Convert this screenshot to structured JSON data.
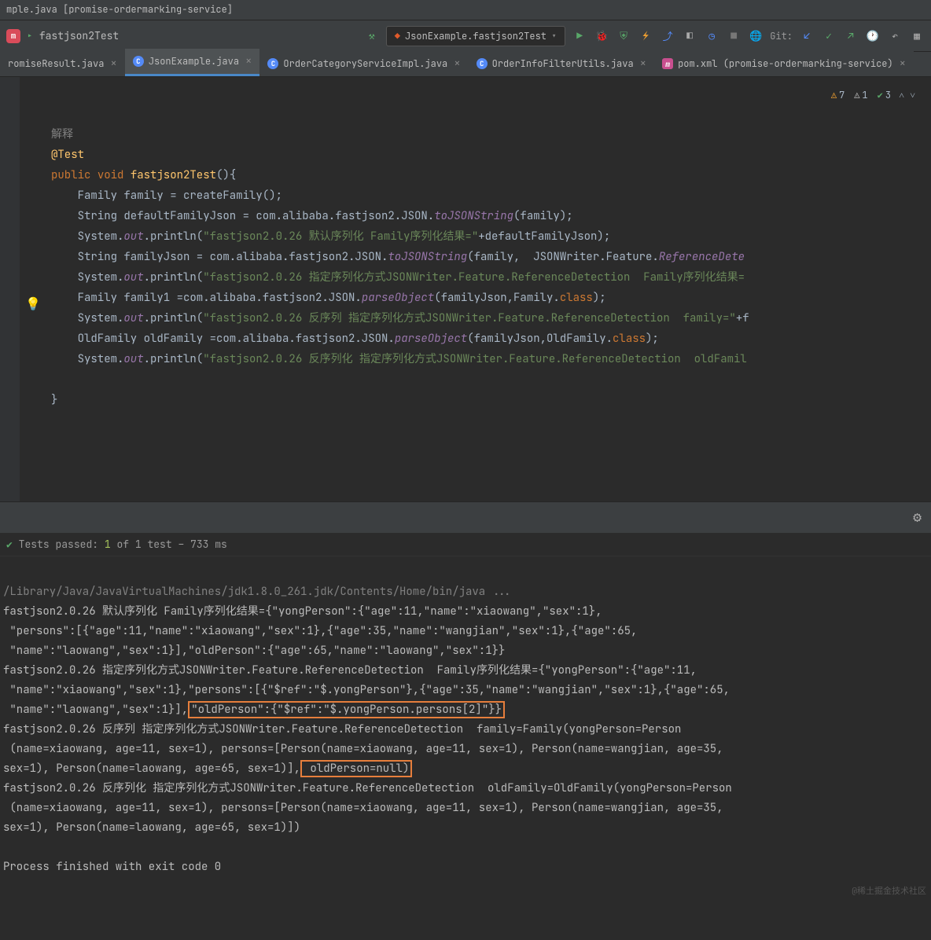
{
  "window": {
    "title": "mple.java [promise-ordermarking-service]"
  },
  "toolbar": {
    "project": "fastjson2Test",
    "run_config": "JsonExample.fastjson2Test",
    "git_label": "Git:"
  },
  "tabs": [
    {
      "icon": "c",
      "label": "romiseResult.java",
      "active": false
    },
    {
      "icon": "c",
      "label": "JsonExample.java",
      "active": true
    },
    {
      "icon": "c",
      "label": "OrderCategoryServiceImpl.java",
      "active": false
    },
    {
      "icon": "c",
      "label": "OrderInfoFilterUtils.java",
      "active": false
    },
    {
      "icon": "m",
      "label": "pom.xml (promise-ordermarking-service)",
      "active": false
    }
  ],
  "inspections": {
    "warn1": "7",
    "warn2": "1",
    "ok": "3"
  },
  "code": {
    "line1_comment": "解释",
    "line2_anno": "@Test",
    "line3_pub": "public ",
    "line3_void": "void ",
    "line3_fn": "fastjson2Test",
    "line3_rest": "(){",
    "line4": "    Family family = createFamily();",
    "line5a": "    String defaultFamilyJson = com.alibaba.fastjson2.JSON.",
    "line5b": "toJSONString",
    "line5c": "(family);",
    "line6a": "    System.",
    "line6b": "out",
    "line6c": ".println(",
    "line6d": "\"fastjson2.0.26 默认序列化 Family序列化结果=\"",
    "line6e": "+defaultFamilyJson);",
    "line7a": "    String familyJson = com.alibaba.fastjson2.JSON.",
    "line7b": "toJSONString",
    "line7c": "(family,  JSONWriter.Feature.",
    "line7d": "ReferenceDete",
    "line8a": "    System.",
    "line8b": "out",
    "line8c": ".println(",
    "line8d": "\"fastjson2.0.26 指定序列化方式JSONWriter.Feature.ReferenceDetection  Family序列化结果=",
    "line9a": "    Family family1 =com.alibaba.fastjson2.JSON.",
    "line9b": "parseObject",
    "line9c": "(familyJson,Family.",
    "line9d": "class",
    "line9e": ");",
    "line10a": "    System.",
    "line10b": "out",
    "line10c": ".println(",
    "line10d": "\"fastjson2.0.26 反序列 指定序列化方式JSONWriter.Feature.ReferenceDetection  family=\"",
    "line10e": "+f",
    "line11a": "    OldFamily oldFamily =com.alibaba.fastjson2.JSON.",
    "line11b": "parseObject",
    "line11c": "(familyJson,OldFamily.",
    "line11d": "class",
    "line11e": ");",
    "line12a": "    System.",
    "line12b": "out",
    "line12c": ".println(",
    "line12d": "\"fastjson2.0.26",
    "line12e": " 反序列化 指定序列化方式JSONWriter.Feature.ReferenceDetection  oldFamil",
    "line14": "}"
  },
  "test_status": {
    "prefix": "Tests passed: ",
    "passed": "1",
    "suffix": " of 1 test – 733 ms"
  },
  "console": {
    "cmd": "/Library/Java/JavaVirtualMachines/jdk1.8.0_261.jdk/Contents/Home/bin/java ...",
    "l1": "fastjson2.0.26 默认序列化 Family序列化结果={\"yongPerson\":{\"age\":11,\"name\":\"xiaowang\",\"sex\":1},",
    "l2": " \"persons\":[{\"age\":11,\"name\":\"xiaowang\",\"sex\":1},{\"age\":35,\"name\":\"wangjian\",\"sex\":1},{\"age\":65,",
    "l3": " \"name\":\"laowang\",\"sex\":1}],\"oldPerson\":{\"age\":65,\"name\":\"laowang\",\"sex\":1}}",
    "l4": "fastjson2.0.26 指定序列化方式JSONWriter.Feature.ReferenceDetection  Family序列化结果={\"yongPerson\":{\"age\":11,",
    "l5": " \"name\":\"xiaowang\",\"sex\":1},\"persons\":[{\"$ref\":\"$.yongPerson\"},{\"age\":35,\"name\":\"wangjian\",\"sex\":1},{\"age\":65,",
    "l6a": " \"name\":\"laowang\",\"sex\":1}],",
    "l6b": "\"oldPerson\":{\"$ref\":\"$.yongPerson.persons[2]\"}}",
    "l7": "fastjson2.0.26 反序列 指定序列化方式JSONWriter.Feature.ReferenceDetection  family=Family(yongPerson=Person",
    "l8": " (name=xiaowang, age=11, sex=1), persons=[Person(name=xiaowang, age=11, sex=1), Person(name=wangjian, age=35, ",
    "l9a": "sex=1), Person(name=laowang, age=65, sex=1)],",
    "l9b": " oldPerson=null)",
    "l10": "fastjson2.0.26 反序列化 指定序列化方式JSONWriter.Feature.ReferenceDetection  oldFamily=OldFamily(yongPerson=Person",
    "l11": " (name=xiaowang, age=11, sex=1), persons=[Person(name=xiaowang, age=11, sex=1), Person(name=wangjian, age=35, ",
    "l12": "sex=1), Person(name=laowang, age=65, sex=1)])",
    "exit": "Process finished with exit code 0"
  },
  "watermark": "@稀土掘金技术社区"
}
